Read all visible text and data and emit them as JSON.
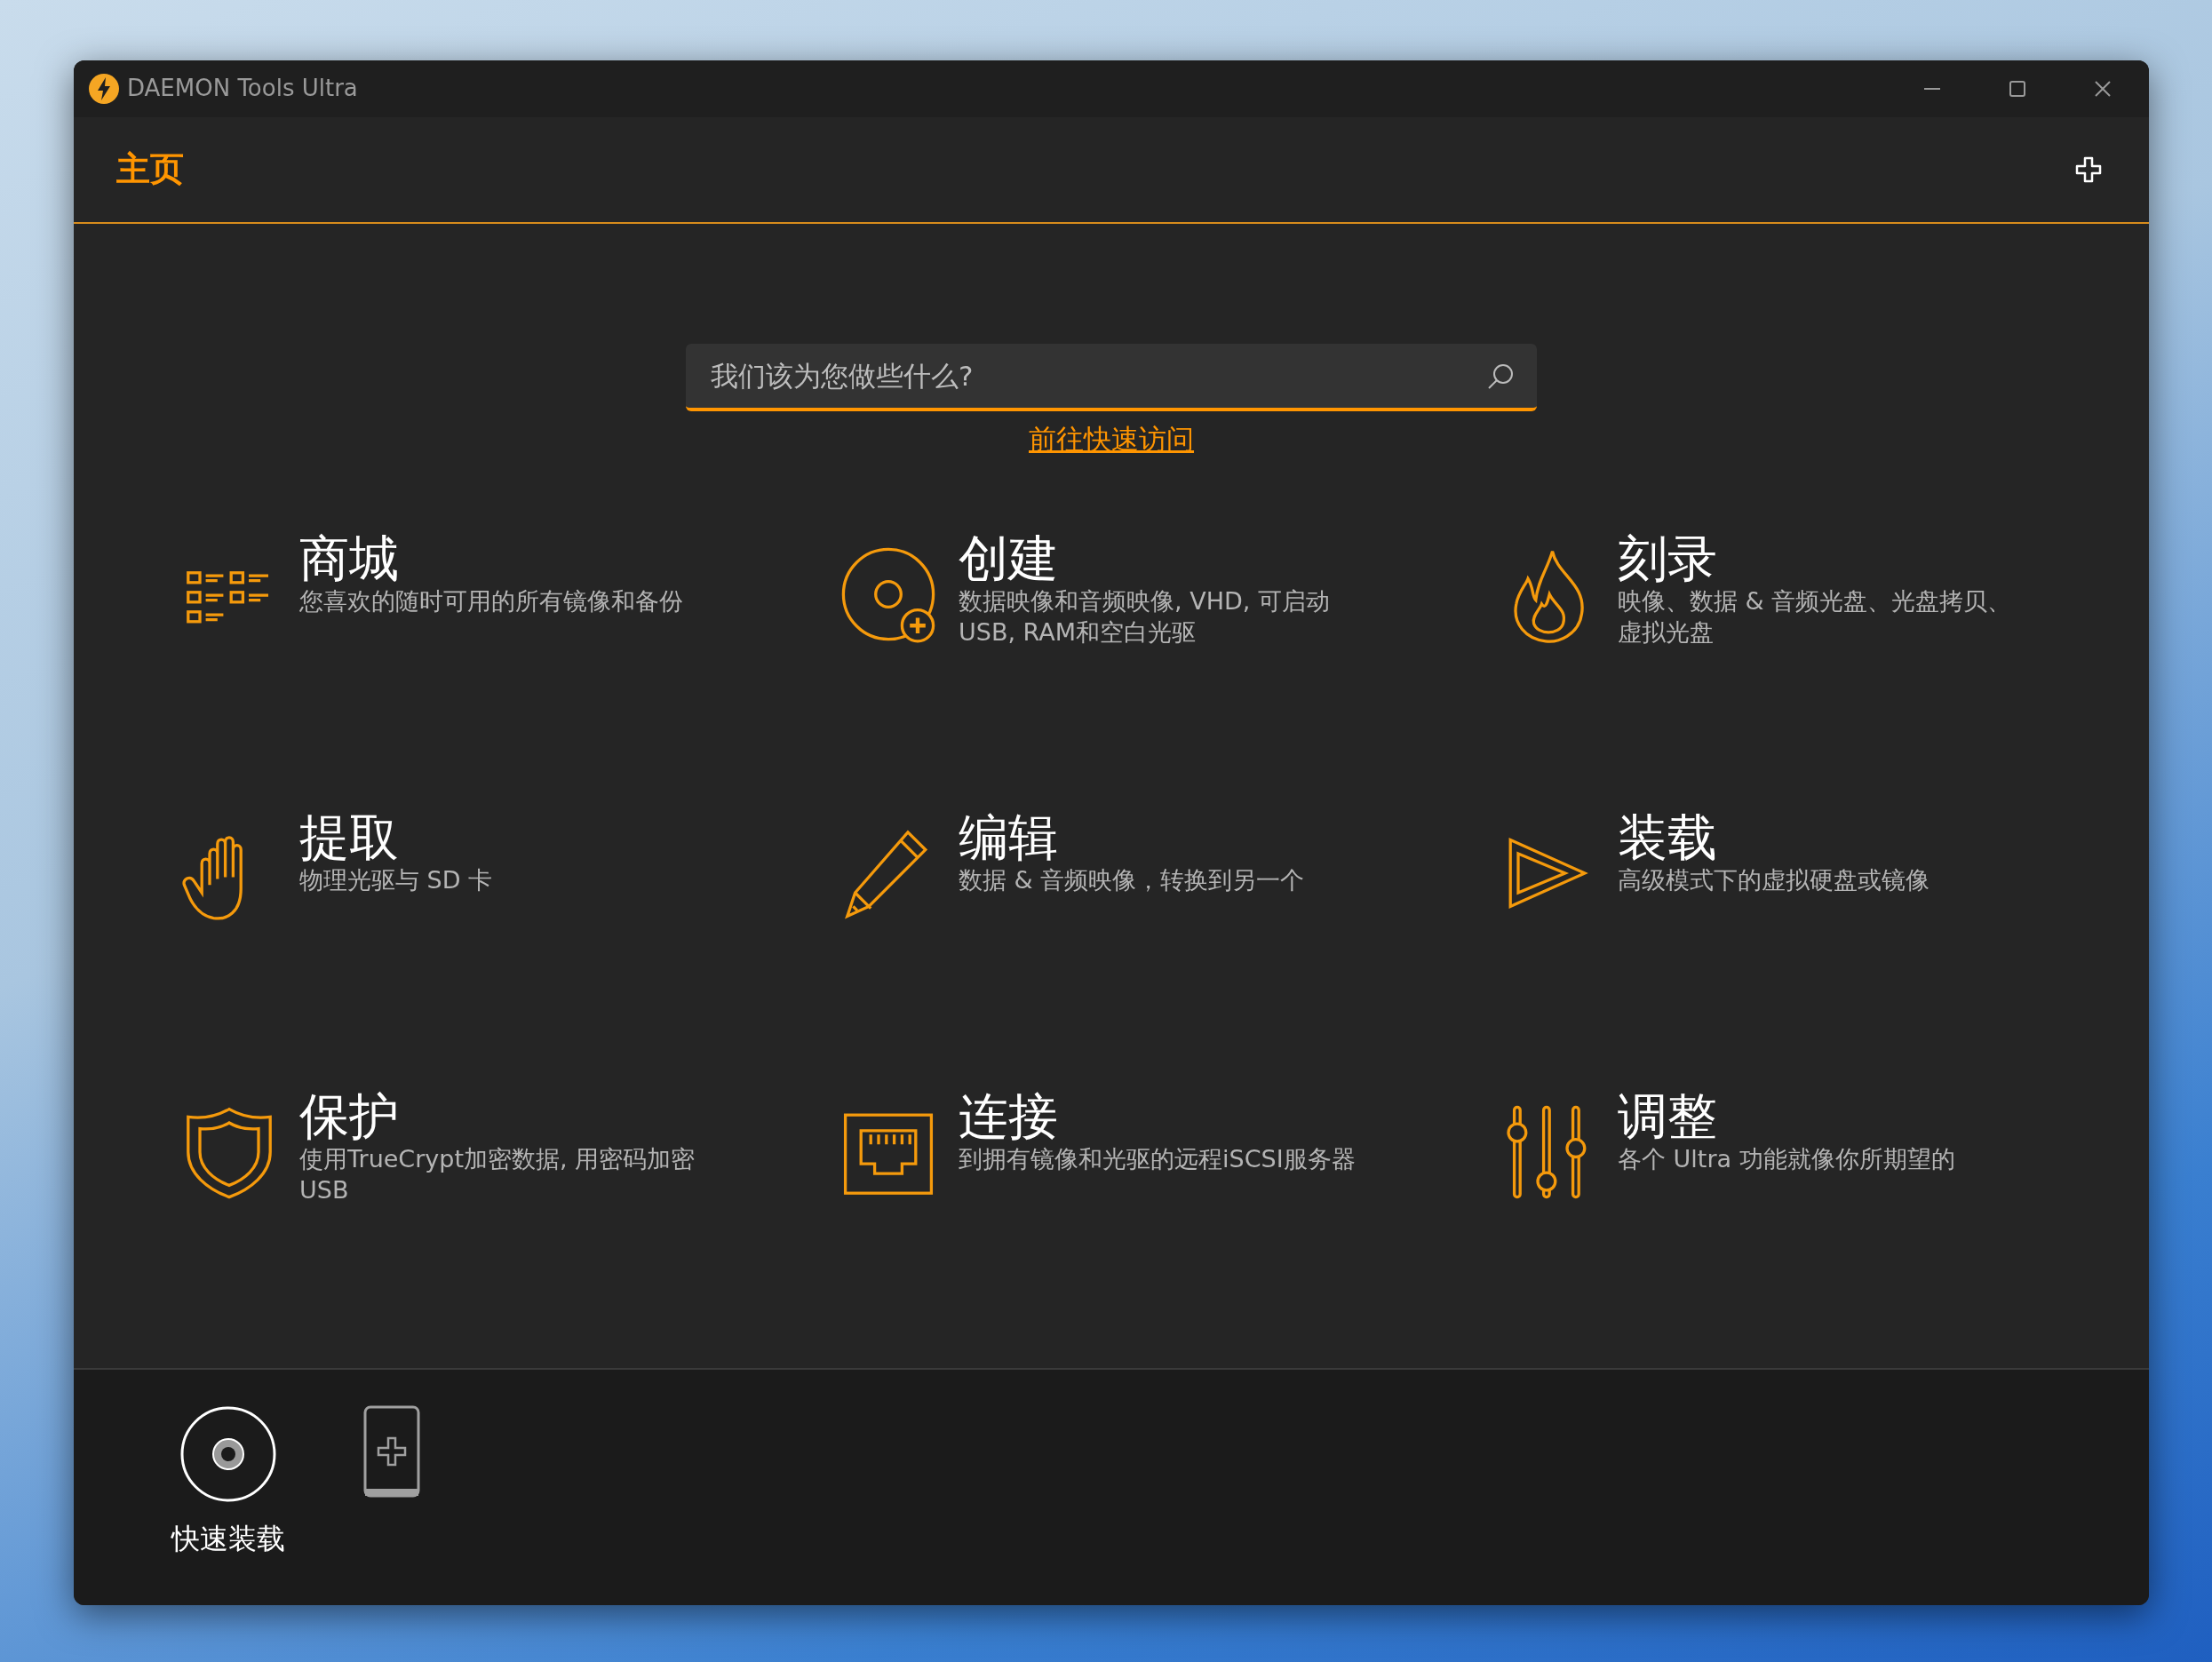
{
  "window": {
    "title": "DAEMON Tools Ultra"
  },
  "header": {
    "title": "主页"
  },
  "search": {
    "placeholder": "我们该为您做些什么?"
  },
  "quick_access_link": "前往快速访问",
  "tiles": [
    {
      "title": "商城",
      "description": "您喜欢的随时可用的所有镜像和备份"
    },
    {
      "title": "创建",
      "description": "数据映像和音频映像, VHD, 可启动USB, RAM和空白光驱"
    },
    {
      "title": "刻录",
      "description": "映像、数据 & 音频光盘、光盘拷贝、虚拟光盘"
    },
    {
      "title": "提取",
      "description": "物理光驱与 SD 卡"
    },
    {
      "title": "编辑",
      "description": "数据 & 音频映像，转换到另一个"
    },
    {
      "title": "装载",
      "description": "高级模式下的虚拟硬盘或镜像"
    },
    {
      "title": "保护",
      "description": "使用TrueCrypt加密数据, 用密码加密USB"
    },
    {
      "title": "连接",
      "description": "到拥有镜像和光驱的远程iSCSI服务器"
    },
    {
      "title": "调整",
      "description": "各个 Ultra 功能就像你所期望的"
    }
  ],
  "bottom_bar": {
    "items": [
      {
        "label": "快速装载"
      }
    ]
  }
}
